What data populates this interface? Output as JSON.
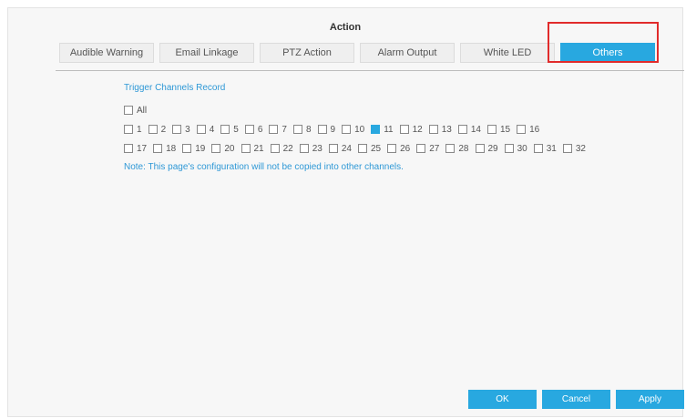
{
  "dialog": {
    "title": "Action"
  },
  "tabs": [
    {
      "label": "Audible Warning",
      "active": false
    },
    {
      "label": "Email Linkage",
      "active": false
    },
    {
      "label": "PTZ Action",
      "active": false
    },
    {
      "label": "Alarm Output",
      "active": false
    },
    {
      "label": "White LED",
      "active": false
    },
    {
      "label": "Others",
      "active": true
    }
  ],
  "section": {
    "title": "Trigger Channels Record",
    "all": {
      "label": "All",
      "checked": false
    },
    "channels_row1": [
      {
        "label": "1",
        "checked": false
      },
      {
        "label": "2",
        "checked": false
      },
      {
        "label": "3",
        "checked": false
      },
      {
        "label": "4",
        "checked": false
      },
      {
        "label": "5",
        "checked": false
      },
      {
        "label": "6",
        "checked": false
      },
      {
        "label": "7",
        "checked": false
      },
      {
        "label": "8",
        "checked": false
      },
      {
        "label": "9",
        "checked": false
      },
      {
        "label": "10",
        "checked": false
      },
      {
        "label": "11",
        "checked": true
      },
      {
        "label": "12",
        "checked": false
      },
      {
        "label": "13",
        "checked": false
      },
      {
        "label": "14",
        "checked": false
      },
      {
        "label": "15",
        "checked": false
      },
      {
        "label": "16",
        "checked": false
      }
    ],
    "channels_row2": [
      {
        "label": "17",
        "checked": false
      },
      {
        "label": "18",
        "checked": false
      },
      {
        "label": "19",
        "checked": false
      },
      {
        "label": "20",
        "checked": false
      },
      {
        "label": "21",
        "checked": false
      },
      {
        "label": "22",
        "checked": false
      },
      {
        "label": "23",
        "checked": false
      },
      {
        "label": "24",
        "checked": false
      },
      {
        "label": "25",
        "checked": false
      },
      {
        "label": "26",
        "checked": false
      },
      {
        "label": "27",
        "checked": false
      },
      {
        "label": "28",
        "checked": false
      },
      {
        "label": "29",
        "checked": false
      },
      {
        "label": "30",
        "checked": false
      },
      {
        "label": "31",
        "checked": false
      },
      {
        "label": "32",
        "checked": false
      }
    ],
    "note": "Note: This page's configuration will not be copied into other channels."
  },
  "footer": {
    "ok_label": "OK",
    "cancel_label": "Cancel",
    "apply_label": "Apply"
  },
  "colors": {
    "accent": "#28a8e0",
    "highlight": "#e12b2b",
    "link_text": "#2e98d6"
  }
}
